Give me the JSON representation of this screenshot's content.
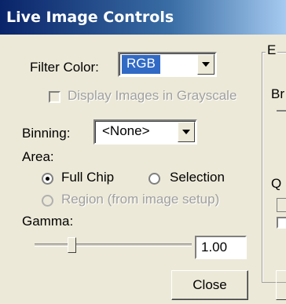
{
  "window": {
    "title": "Live Image Controls"
  },
  "filter_color": {
    "label": "Filter Color:",
    "value": "RGB"
  },
  "grayscale": {
    "label": "Display Images in Grayscale",
    "checked": false,
    "enabled": false
  },
  "binning": {
    "label": "Binning:",
    "value": "<None>"
  },
  "area": {
    "label": "Area:",
    "options": [
      {
        "label": "Full Chip",
        "selected": true,
        "enabled": true
      },
      {
        "label": "Selection",
        "selected": false,
        "enabled": true
      },
      {
        "label": "Region (from image setup)",
        "selected": false,
        "enabled": false
      }
    ]
  },
  "gamma": {
    "label": "Gamma:",
    "value": "1.00"
  },
  "close_button": {
    "label": "Close"
  },
  "right_panel": {
    "group_label": "E",
    "label_b": "Br",
    "label_q": "Q"
  }
}
